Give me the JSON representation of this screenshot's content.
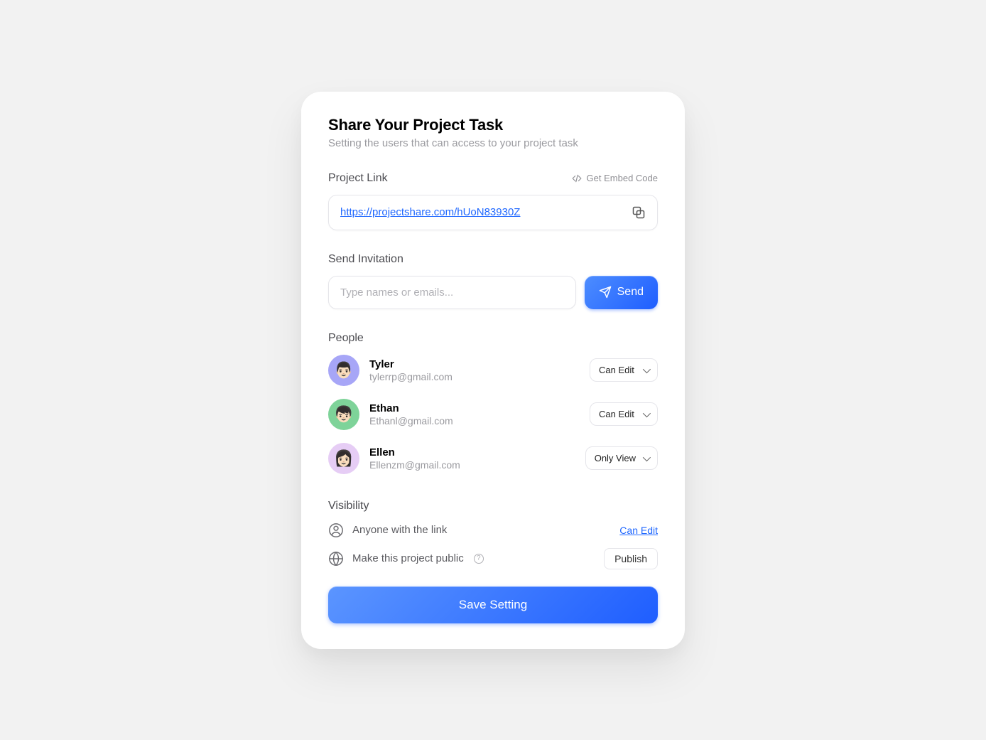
{
  "header": {
    "title": "Share Your Project Task",
    "subtitle": "Setting the users that can access to your project task"
  },
  "projectLink": {
    "label": "Project Link",
    "embedLabel": "Get Embed Code",
    "url": "https://projectshare.com/hUoN83930Z"
  },
  "invitation": {
    "label": "Send Invitation",
    "placeholder": "Type names or emails...",
    "sendLabel": "Send"
  },
  "people": {
    "label": "People",
    "items": [
      {
        "name": "Tyler",
        "email": "tylerrp@gmail.com",
        "permission": "Can Edit",
        "avatarClass": "purple",
        "emoji": "👨🏻"
      },
      {
        "name": "Ethan",
        "email": "Ethanl@gmail.com",
        "permission": "Can Edit",
        "avatarClass": "green",
        "emoji": "👦🏻"
      },
      {
        "name": "Ellen",
        "email": "Ellenzm@gmail.com",
        "permission": "Only View",
        "avatarClass": "pink",
        "emoji": "👩🏻"
      }
    ]
  },
  "visibility": {
    "label": "Visibility",
    "linkAccess": {
      "text": "Anyone with the link",
      "action": "Can Edit"
    },
    "public": {
      "text": "Make this project public",
      "action": "Publish"
    }
  },
  "footer": {
    "saveLabel": "Save Setting"
  }
}
